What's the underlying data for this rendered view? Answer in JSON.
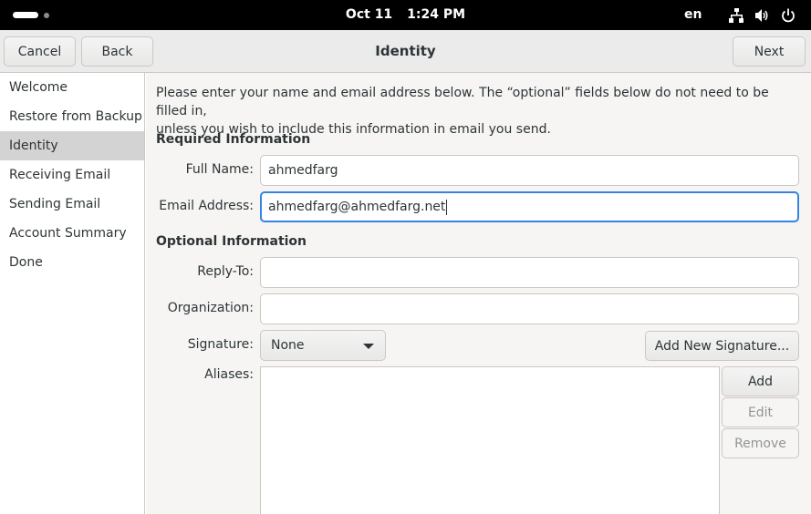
{
  "system_bar": {
    "date": "Oct 11",
    "time": "1:24 PM",
    "language": "en",
    "tray_icons": [
      "network-icon",
      "volume-icon",
      "power-icon"
    ]
  },
  "header": {
    "cancel_label": "Cancel",
    "back_label": "Back",
    "title": "Identity",
    "next_label": "Next"
  },
  "sidebar": {
    "items": [
      {
        "label": "Welcome"
      },
      {
        "label": "Restore from Backup"
      },
      {
        "label": "Identity",
        "active": true
      },
      {
        "label": "Receiving Email"
      },
      {
        "label": "Sending Email"
      },
      {
        "label": "Account Summary"
      },
      {
        "label": "Done"
      }
    ]
  },
  "form": {
    "intro_line1": "Please enter your name and email address below. The “optional” fields below do not need to be filled in,",
    "intro_line2": "unless you wish to include this information in email you send.",
    "required_heading": "Required Information",
    "full_name_label": "Full Name:",
    "full_name_value": "ahmedfarg",
    "email_label": "Email Address:",
    "email_value": "ahmedfarg@ahmedfarg.net",
    "optional_heading": "Optional Information",
    "reply_to_label": "Reply-To:",
    "reply_to_value": "",
    "organization_label": "Organization:",
    "organization_value": "",
    "signature_label": "Signature:",
    "signature_value": "None",
    "add_signature_label": "Add New Signature...",
    "aliases_label": "Aliases:",
    "add_label": "Add",
    "edit_label": "Edit",
    "remove_label": "Remove"
  },
  "colors": {
    "focus_accent": "#3584e4",
    "sidebar_selected": "#d3d3d3"
  }
}
